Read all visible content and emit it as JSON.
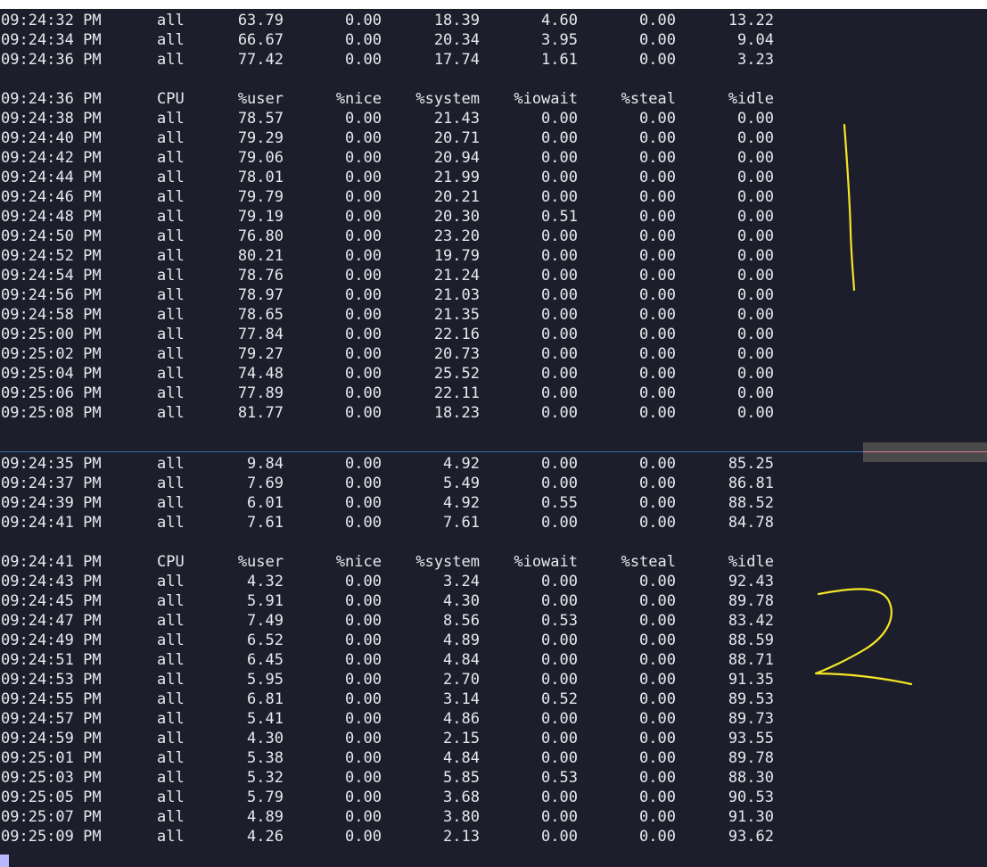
{
  "pane1": {
    "rows": [
      [
        "09:24:32 PM",
        "all",
        "63.79",
        "0.00",
        "18.39",
        "4.60",
        "0.00",
        "13.22"
      ],
      [
        "09:24:34 PM",
        "all",
        "66.67",
        "0.00",
        "20.34",
        "3.95",
        "0.00",
        "9.04"
      ],
      [
        "09:24:36 PM",
        "all",
        "77.42",
        "0.00",
        "17.74",
        "1.61",
        "0.00",
        "3.23"
      ],
      [],
      [
        "09:24:36 PM",
        "CPU",
        "%user",
        "%nice",
        "%system",
        "%iowait",
        "%steal",
        "%idle"
      ],
      [
        "09:24:38 PM",
        "all",
        "78.57",
        "0.00",
        "21.43",
        "0.00",
        "0.00",
        "0.00"
      ],
      [
        "09:24:40 PM",
        "all",
        "79.29",
        "0.00",
        "20.71",
        "0.00",
        "0.00",
        "0.00"
      ],
      [
        "09:24:42 PM",
        "all",
        "79.06",
        "0.00",
        "20.94",
        "0.00",
        "0.00",
        "0.00"
      ],
      [
        "09:24:44 PM",
        "all",
        "78.01",
        "0.00",
        "21.99",
        "0.00",
        "0.00",
        "0.00"
      ],
      [
        "09:24:46 PM",
        "all",
        "79.79",
        "0.00",
        "20.21",
        "0.00",
        "0.00",
        "0.00"
      ],
      [
        "09:24:48 PM",
        "all",
        "79.19",
        "0.00",
        "20.30",
        "0.51",
        "0.00",
        "0.00"
      ],
      [
        "09:24:50 PM",
        "all",
        "76.80",
        "0.00",
        "23.20",
        "0.00",
        "0.00",
        "0.00"
      ],
      [
        "09:24:52 PM",
        "all",
        "80.21",
        "0.00",
        "19.79",
        "0.00",
        "0.00",
        "0.00"
      ],
      [
        "09:24:54 PM",
        "all",
        "78.76",
        "0.00",
        "21.24",
        "0.00",
        "0.00",
        "0.00"
      ],
      [
        "09:24:56 PM",
        "all",
        "78.97",
        "0.00",
        "21.03",
        "0.00",
        "0.00",
        "0.00"
      ],
      [
        "09:24:58 PM",
        "all",
        "78.65",
        "0.00",
        "21.35",
        "0.00",
        "0.00",
        "0.00"
      ],
      [
        "09:25:00 PM",
        "all",
        "77.84",
        "0.00",
        "22.16",
        "0.00",
        "0.00",
        "0.00"
      ],
      [
        "09:25:02 PM",
        "all",
        "79.27",
        "0.00",
        "20.73",
        "0.00",
        "0.00",
        "0.00"
      ],
      [
        "09:25:04 PM",
        "all",
        "74.48",
        "0.00",
        "25.52",
        "0.00",
        "0.00",
        "0.00"
      ],
      [
        "09:25:06 PM",
        "all",
        "77.89",
        "0.00",
        "22.11",
        "0.00",
        "0.00",
        "0.00"
      ],
      [
        "09:25:08 PM",
        "all",
        "81.77",
        "0.00",
        "18.23",
        "0.00",
        "0.00",
        "0.00"
      ]
    ]
  },
  "pane2": {
    "rows": [
      [
        "09:24:35 PM",
        "all",
        "9.84",
        "0.00",
        "4.92",
        "0.00",
        "0.00",
        "85.25"
      ],
      [
        "09:24:37 PM",
        "all",
        "7.69",
        "0.00",
        "5.49",
        "0.00",
        "0.00",
        "86.81"
      ],
      [
        "09:24:39 PM",
        "all",
        "6.01",
        "0.00",
        "4.92",
        "0.55",
        "0.00",
        "88.52"
      ],
      [
        "09:24:41 PM",
        "all",
        "7.61",
        "0.00",
        "7.61",
        "0.00",
        "0.00",
        "84.78"
      ],
      [],
      [
        "09:24:41 PM",
        "CPU",
        "%user",
        "%nice",
        "%system",
        "%iowait",
        "%steal",
        "%idle"
      ],
      [
        "09:24:43 PM",
        "all",
        "4.32",
        "0.00",
        "3.24",
        "0.00",
        "0.00",
        "92.43"
      ],
      [
        "09:24:45 PM",
        "all",
        "5.91",
        "0.00",
        "4.30",
        "0.00",
        "0.00",
        "89.78"
      ],
      [
        "09:24:47 PM",
        "all",
        "7.49",
        "0.00",
        "8.56",
        "0.53",
        "0.00",
        "83.42"
      ],
      [
        "09:24:49 PM",
        "all",
        "6.52",
        "0.00",
        "4.89",
        "0.00",
        "0.00",
        "88.59"
      ],
      [
        "09:24:51 PM",
        "all",
        "6.45",
        "0.00",
        "4.84",
        "0.00",
        "0.00",
        "88.71"
      ],
      [
        "09:24:53 PM",
        "all",
        "5.95",
        "0.00",
        "2.70",
        "0.00",
        "0.00",
        "91.35"
      ],
      [
        "09:24:55 PM",
        "all",
        "6.81",
        "0.00",
        "3.14",
        "0.52",
        "0.00",
        "89.53"
      ],
      [
        "09:24:57 PM",
        "all",
        "5.41",
        "0.00",
        "4.86",
        "0.00",
        "0.00",
        "89.73"
      ],
      [
        "09:24:59 PM",
        "all",
        "4.30",
        "0.00",
        "2.15",
        "0.00",
        "0.00",
        "93.55"
      ],
      [
        "09:25:01 PM",
        "all",
        "5.38",
        "0.00",
        "4.84",
        "0.00",
        "0.00",
        "89.78"
      ],
      [
        "09:25:03 PM",
        "all",
        "5.32",
        "0.00",
        "5.85",
        "0.53",
        "0.00",
        "88.30"
      ],
      [
        "09:25:05 PM",
        "all",
        "5.79",
        "0.00",
        "3.68",
        "0.00",
        "0.00",
        "90.53"
      ],
      [
        "09:25:07 PM",
        "all",
        "4.89",
        "0.00",
        "3.80",
        "0.00",
        "0.00",
        "91.30"
      ],
      [
        "09:25:09 PM",
        "all",
        "4.26",
        "0.00",
        "2.13",
        "0.00",
        "0.00",
        "93.62"
      ]
    ]
  },
  "annotations": {
    "pane1_mark": "1",
    "pane2_mark": "2",
    "color": "#f5e625"
  },
  "colors": {
    "terminal_bg": "#1c1e2b",
    "text": "#e8e8ee",
    "divider": "#2f6fa8"
  }
}
